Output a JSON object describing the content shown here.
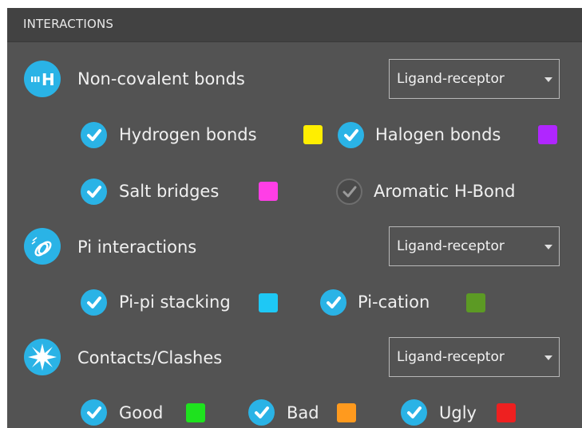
{
  "header": {
    "title": "INTERACTIONS"
  },
  "sections": [
    {
      "icon": "hydrogen-bond-icon",
      "label": "Non-covalent bonds",
      "dropdown": "Ligand-receptor",
      "items": [
        {
          "label": "Hydrogen bonds",
          "checked": true,
          "color": "#ffee00"
        },
        {
          "label": "Halogen bonds",
          "checked": true,
          "color": "#b026ff"
        },
        {
          "label": "Salt bridges",
          "checked": true,
          "color": "#ff3ee6"
        },
        {
          "label": "Aromatic H-Bond",
          "checked": false
        }
      ]
    },
    {
      "icon": "pi-interaction-icon",
      "label": "Pi interactions",
      "dropdown": "Ligand-receptor",
      "items": [
        {
          "label": "Pi-pi stacking",
          "checked": true,
          "color": "#1ec8f5"
        },
        {
          "label": "Pi-cation",
          "checked": true,
          "color": "#5c9a24"
        }
      ]
    },
    {
      "icon": "contacts-burst-icon",
      "label": "Contacts/Clashes",
      "dropdown": "Ligand-receptor",
      "items": [
        {
          "label": "Good",
          "checked": true,
          "color": "#1ee21e"
        },
        {
          "label": "Bad",
          "checked": true,
          "color": "#ff9a1e"
        },
        {
          "label": "Ugly",
          "checked": true,
          "color": "#ee2020"
        }
      ]
    }
  ]
}
